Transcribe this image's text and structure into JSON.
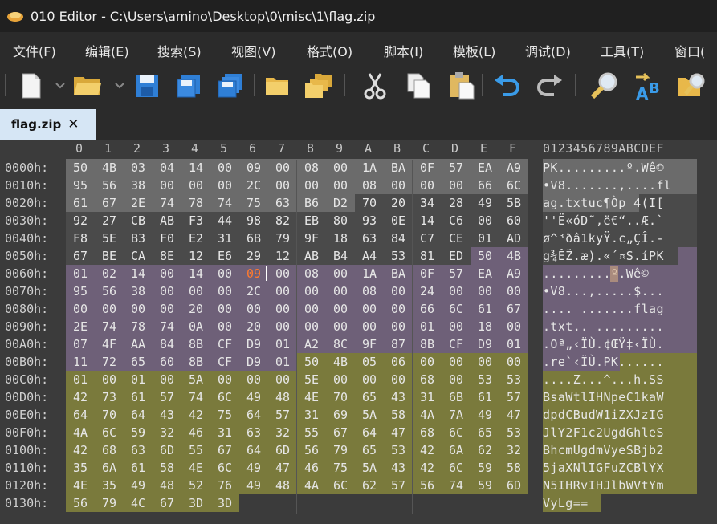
{
  "window": {
    "title": "010 Editor - C:\\Users\\amino\\Desktop\\0\\misc\\1\\flag.zip"
  },
  "menu": [
    {
      "label": "文件(F)"
    },
    {
      "label": "编辑(E)"
    },
    {
      "label": "搜索(S)"
    },
    {
      "label": "视图(V)"
    },
    {
      "label": "格式(O)"
    },
    {
      "label": "脚本(I)"
    },
    {
      "label": "模板(L)"
    },
    {
      "label": "调试(D)"
    },
    {
      "label": "工具(T)"
    },
    {
      "label": "窗口("
    }
  ],
  "toolbar": [
    {
      "icon": "new-file-icon"
    },
    {
      "icon": "open-folder-icon"
    },
    {
      "icon": "save-icon"
    },
    {
      "icon": "save-as-icon"
    },
    {
      "icon": "save-all-icon"
    },
    {
      "icon": "folder-icon"
    },
    {
      "icon": "folders-icon"
    },
    {
      "icon": "cut-icon"
    },
    {
      "icon": "copy-icon"
    },
    {
      "icon": "paste-icon"
    },
    {
      "icon": "undo-icon"
    },
    {
      "icon": "redo-icon"
    },
    {
      "icon": "find-icon"
    },
    {
      "icon": "replace-icon"
    },
    {
      "icon": "find-in-files-icon"
    }
  ],
  "tab": {
    "label": "flag.zip",
    "close": "✕"
  },
  "hex_header": [
    "0",
    "1",
    "2",
    "3",
    "4",
    "5",
    "6",
    "7",
    "8",
    "9",
    "A",
    "B",
    "C",
    "D",
    "E",
    "F"
  ],
  "ascii_header": "0123456789ABCDEF",
  "rows": [
    {
      "addr": "0000h:",
      "bytes": [
        "50",
        "4B",
        "03",
        "04",
        "14",
        "00",
        "09",
        "00",
        "08",
        "00",
        "1A",
        "BA",
        "0F",
        "57",
        "EA",
        "A9"
      ],
      "ascii": "PK.........º.Wê©"
    },
    {
      "addr": "0010h:",
      "bytes": [
        "95",
        "56",
        "38",
        "00",
        "00",
        "00",
        "2C",
        "00",
        "00",
        "00",
        "08",
        "00",
        "00",
        "00",
        "66",
        "6C"
      ],
      "ascii": "•V8.......,....fl"
    },
    {
      "addr": "0020h:",
      "bytes": [
        "61",
        "67",
        "2E",
        "74",
        "78",
        "74",
        "75",
        "63",
        "B6",
        "D2",
        "70",
        "20",
        "34",
        "28",
        "49",
        "5B"
      ],
      "ascii": "ag.txtuc¶Òp 4(I["
    },
    {
      "addr": "0030h:",
      "bytes": [
        "92",
        "27",
        "CB",
        "AB",
        "F3",
        "44",
        "98",
        "82",
        "EB",
        "80",
        "93",
        "0E",
        "14",
        "C6",
        "00",
        "60"
      ],
      "ascii": "''Ë«óD˜‚ë€“..Æ.`"
    },
    {
      "addr": "0040h:",
      "bytes": [
        "F8",
        "5E",
        "B3",
        "F0",
        "E2",
        "31",
        "6B",
        "79",
        "9F",
        "18",
        "63",
        "84",
        "C7",
        "CE",
        "01",
        "AD"
      ],
      "ascii": "ø^³ðâ1kyŸ.c„ÇÎ.-"
    },
    {
      "addr": "0050h:",
      "bytes": [
        "67",
        "BE",
        "CA",
        "8E",
        "12",
        "E6",
        "29",
        "12",
        "AB",
        "B4",
        "A4",
        "53",
        "81",
        "ED",
        "50",
        "4B"
      ],
      "ascii": "g¾ÊŽ.æ).«´¤S.íPK"
    },
    {
      "addr": "0060h:",
      "bytes": [
        "01",
        "02",
        "14",
        "00",
        "14",
        "00",
        "09",
        "00",
        "08",
        "00",
        "1A",
        "BA",
        "0F",
        "57",
        "EA",
        "A9"
      ],
      "ascii": ".........º.Wê©"
    },
    {
      "addr": "0070h:",
      "bytes": [
        "95",
        "56",
        "38",
        "00",
        "00",
        "00",
        "2C",
        "00",
        "00",
        "00",
        "08",
        "00",
        "24",
        "00",
        "00",
        "00"
      ],
      "ascii": "•V8...,.....$..."
    },
    {
      "addr": "0080h:",
      "bytes": [
        "00",
        "00",
        "00",
        "00",
        "20",
        "00",
        "00",
        "00",
        "00",
        "00",
        "00",
        "00",
        "66",
        "6C",
        "61",
        "67"
      ],
      "ascii": ".... .......flag"
    },
    {
      "addr": "0090h:",
      "bytes": [
        "2E",
        "74",
        "78",
        "74",
        "0A",
        "00",
        "20",
        "00",
        "00",
        "00",
        "00",
        "00",
        "01",
        "00",
        "18",
        "00"
      ],
      "ascii": ".txt.. ........."
    },
    {
      "addr": "00A0h:",
      "bytes": [
        "07",
        "4F",
        "AA",
        "84",
        "8B",
        "CF",
        "D9",
        "01",
        "A2",
        "8C",
        "9F",
        "87",
        "8B",
        "CF",
        "D9",
        "01"
      ],
      "ascii": ".Oª„‹ÏÙ.¢ŒŸ‡‹ÏÙ."
    },
    {
      "addr": "00B0h:",
      "bytes": [
        "11",
        "72",
        "65",
        "60",
        "8B",
        "CF",
        "D9",
        "01",
        "50",
        "4B",
        "05",
        "06",
        "00",
        "00",
        "00",
        "00"
      ],
      "ascii": ".re`‹ÏÙ.PK......"
    },
    {
      "addr": "00C0h:",
      "bytes": [
        "01",
        "00",
        "01",
        "00",
        "5A",
        "00",
        "00",
        "00",
        "5E",
        "00",
        "00",
        "00",
        "68",
        "00",
        "53",
        "53"
      ],
      "ascii": "....Z...^...h.SS"
    },
    {
      "addr": "00D0h:",
      "bytes": [
        "42",
        "73",
        "61",
        "57",
        "74",
        "6C",
        "49",
        "48",
        "4E",
        "70",
        "65",
        "43",
        "31",
        "6B",
        "61",
        "57"
      ],
      "ascii": "BsaWtlIHNpeC1kaW"
    },
    {
      "addr": "00E0h:",
      "bytes": [
        "64",
        "70",
        "64",
        "43",
        "42",
        "75",
        "64",
        "57",
        "31",
        "69",
        "5A",
        "58",
        "4A",
        "7A",
        "49",
        "47"
      ],
      "ascii": "dpdCBudW1iZXJzIG"
    },
    {
      "addr": "00F0h:",
      "bytes": [
        "4A",
        "6C",
        "59",
        "32",
        "46",
        "31",
        "63",
        "32",
        "55",
        "67",
        "64",
        "47",
        "68",
        "6C",
        "65",
        "53"
      ],
      "ascii": "JlY2F1c2UgdGhleS"
    },
    {
      "addr": "0100h:",
      "bytes": [
        "42",
        "68",
        "63",
        "6D",
        "55",
        "67",
        "64",
        "6D",
        "56",
        "79",
        "65",
        "53",
        "42",
        "6A",
        "62",
        "32"
      ],
      "ascii": "BhcmUgdmVyeSBjb2"
    },
    {
      "addr": "0110h:",
      "bytes": [
        "35",
        "6A",
        "61",
        "58",
        "4E",
        "6C",
        "49",
        "47",
        "46",
        "75",
        "5A",
        "43",
        "42",
        "6C",
        "59",
        "58"
      ],
      "ascii": "5jaXNlIGFuZCBlYX"
    },
    {
      "addr": "0120h:",
      "bytes": [
        "4E",
        "35",
        "49",
        "48",
        "52",
        "76",
        "49",
        "48",
        "4A",
        "6C",
        "62",
        "57",
        "56",
        "74",
        "59",
        "6D"
      ],
      "ascii": "N5IHRvIHJlbWVtYm"
    },
    {
      "addr": "0130h:",
      "bytes": [
        "56",
        "79",
        "4C",
        "67",
        "3D",
        "3D"
      ],
      "ascii": "VyLg=="
    }
  ],
  "colors": {
    "local_header": "#6b6b6b",
    "file_data": "#4a4a4a",
    "central_dir": "#6e6078",
    "end_record": "#7a7a3c",
    "changed_byte": "#ff7a2e",
    "cursor_value": "09"
  }
}
